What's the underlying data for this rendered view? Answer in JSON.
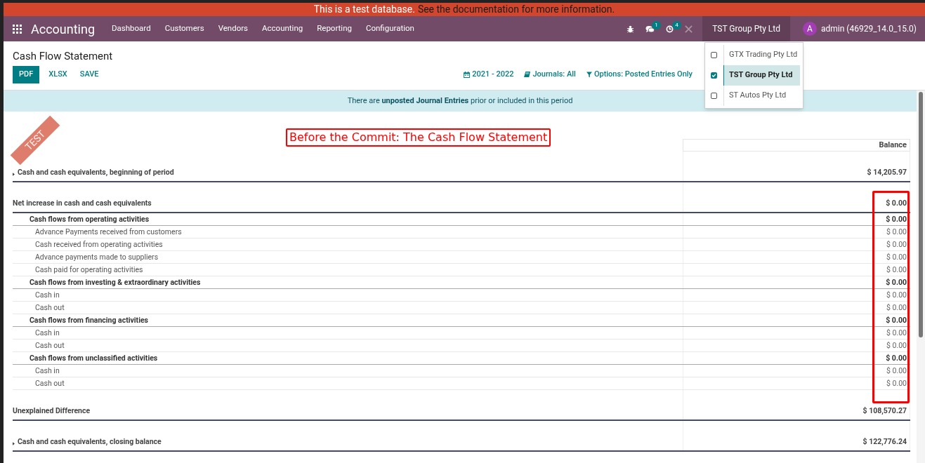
{
  "banner": {
    "text": "This is a test database.",
    "link": "See the documentation for more information."
  },
  "ribbon": {
    "text": "TEST"
  },
  "navbar": {
    "app": "Accounting",
    "menu": [
      "Dashboard",
      "Customers",
      "Vendors",
      "Accounting",
      "Reporting",
      "Configuration"
    ],
    "systray": [
      {
        "kind": "bug"
      },
      {
        "kind": "chat",
        "badge": "1"
      },
      {
        "kind": "clock",
        "badge": "4"
      },
      {
        "kind": "close"
      }
    ],
    "company": "TST Group Pty Ltd",
    "company_open": true,
    "user": {
      "initial": "A",
      "name": "admin (46929_14.0_15.0)"
    }
  },
  "company_menu": [
    {
      "label": "GTX Trading Pty Ltd",
      "checked": false,
      "selected": false
    },
    {
      "label": "TST Group Pty Ltd",
      "checked": true,
      "selected": true
    },
    {
      "label": "ST Autos Pty Ltd",
      "checked": false,
      "selected": false
    }
  ],
  "page": {
    "title": "Cash Flow Statement",
    "buttons": [
      {
        "label": "PDF",
        "primary": true
      },
      {
        "label": "XLSX",
        "primary": false
      },
      {
        "label": "SAVE",
        "primary": false
      }
    ],
    "filters": [
      {
        "kind": "calendar",
        "label": "2021 - 2022"
      },
      {
        "kind": "book",
        "label": "Journals: All"
      },
      {
        "kind": "filter",
        "label": "Options: Posted Entries Only"
      }
    ]
  },
  "notice": "There are **unposted Journal Entries** prior or included in this period",
  "annotation": {
    "title": "Before the Commit: The Cash Flow Statement"
  },
  "table": {
    "columns": [
      "Balance"
    ],
    "rows": [
      {
        "kind": "section",
        "label": "Cash and cash equivalents, beginning of period",
        "balance": "$ 14,205.97",
        "foldable": true
      },
      {
        "kind": "section",
        "label": "Net increase in cash and cash equivalents",
        "balance": "$ 0.00"
      },
      {
        "kind": "group",
        "label": "Cash flows from operating activities",
        "balance": "$ 0.00"
      },
      {
        "kind": "line",
        "label": "Advance Payments received from customers",
        "balance": "$ 0.00"
      },
      {
        "kind": "line",
        "label": "Cash received from operating activities",
        "balance": "$ 0.00"
      },
      {
        "kind": "line",
        "label": "Advance payments made to suppliers",
        "balance": "$ 0.00"
      },
      {
        "kind": "line",
        "label": "Cash paid for operating activities",
        "balance": "$ 0.00"
      },
      {
        "kind": "group",
        "label": "Cash flows from investing & extraordinary activities",
        "balance": "$ 0.00"
      },
      {
        "kind": "line",
        "label": "Cash in",
        "balance": "$ 0.00"
      },
      {
        "kind": "line",
        "label": "Cash out",
        "balance": "$ 0.00"
      },
      {
        "kind": "group",
        "label": "Cash flows from financing activities",
        "balance": "$ 0.00"
      },
      {
        "kind": "line",
        "label": "Cash in",
        "balance": "$ 0.00"
      },
      {
        "kind": "line",
        "label": "Cash out",
        "balance": "$ 0.00"
      },
      {
        "kind": "group",
        "label": "Cash flows from unclassified activities",
        "balance": "$ 0.00"
      },
      {
        "kind": "line",
        "label": "Cash in",
        "balance": "$ 0.00"
      },
      {
        "kind": "line",
        "label": "Cash out",
        "balance": "$ 0.00"
      },
      {
        "kind": "spacer"
      },
      {
        "kind": "section",
        "label": "Unexplained Difference",
        "balance": "$ 108,570.27"
      },
      {
        "kind": "section",
        "label": "Cash and cash equivalents, closing balance",
        "balance": "$ 122,776.24",
        "foldable": true
      }
    ]
  }
}
